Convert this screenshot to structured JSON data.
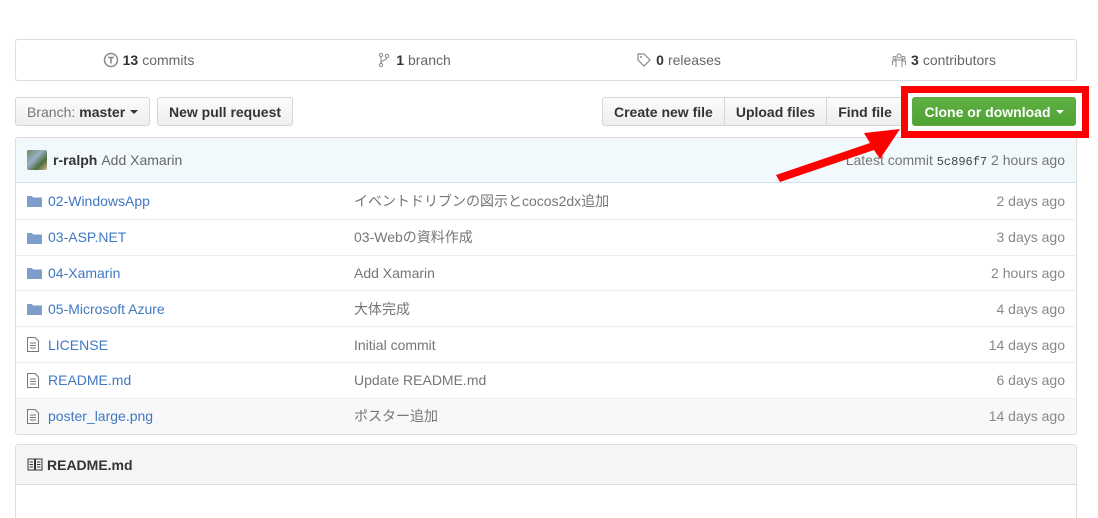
{
  "summary": {
    "commits": {
      "count": "13",
      "label": "commits",
      "icon": "history-icon"
    },
    "branches": {
      "count": "1",
      "label": "branch",
      "icon": "git-branch-icon"
    },
    "releases": {
      "count": "0",
      "label": "releases",
      "icon": "tag-icon"
    },
    "contributors": {
      "count": "3",
      "label": "contributors",
      "icon": "organization-icon"
    }
  },
  "toolbar": {
    "branch_prefix": "Branch:",
    "branch_name": "master",
    "new_pull_request": "New pull request",
    "create_new_file": "Create new file",
    "upload_files": "Upload files",
    "find_file": "Find file",
    "clone_or_download": "Clone or download"
  },
  "annotation": {
    "highlight_color": "#ff0000",
    "target": "Clone or download"
  },
  "latest_commit": {
    "author": "r-ralph",
    "message": "Add Xamarin",
    "prefix": "Latest commit",
    "sha": "5c896f7",
    "age": "2 hours ago"
  },
  "files": [
    {
      "type": "directory",
      "name": "02-WindowsApp",
      "message": "イベントドリブンの図示とcocos2dx追加",
      "age": "2 days ago"
    },
    {
      "type": "directory",
      "name": "03-ASP.NET",
      "message": "03-Webの資料作成",
      "age": "3 days ago"
    },
    {
      "type": "directory",
      "name": "04-Xamarin",
      "message": "Add Xamarin",
      "age": "2 hours ago"
    },
    {
      "type": "directory",
      "name": "05-Microsoft Azure",
      "message": "大体完成",
      "age": "4 days ago"
    },
    {
      "type": "file",
      "name": "LICENSE",
      "message": "Initial commit",
      "age": "14 days ago"
    },
    {
      "type": "file",
      "name": "README.md",
      "message": "Update README.md",
      "age": "6 days ago"
    },
    {
      "type": "file",
      "name": "poster_large.png",
      "message": "ポスター追加",
      "age": "14 days ago"
    }
  ],
  "readme": {
    "title": "README.md"
  },
  "colors": {
    "link": "#4078c0",
    "clone_button": "#55a532",
    "commit_tease_bg": "#f2f9fc"
  }
}
